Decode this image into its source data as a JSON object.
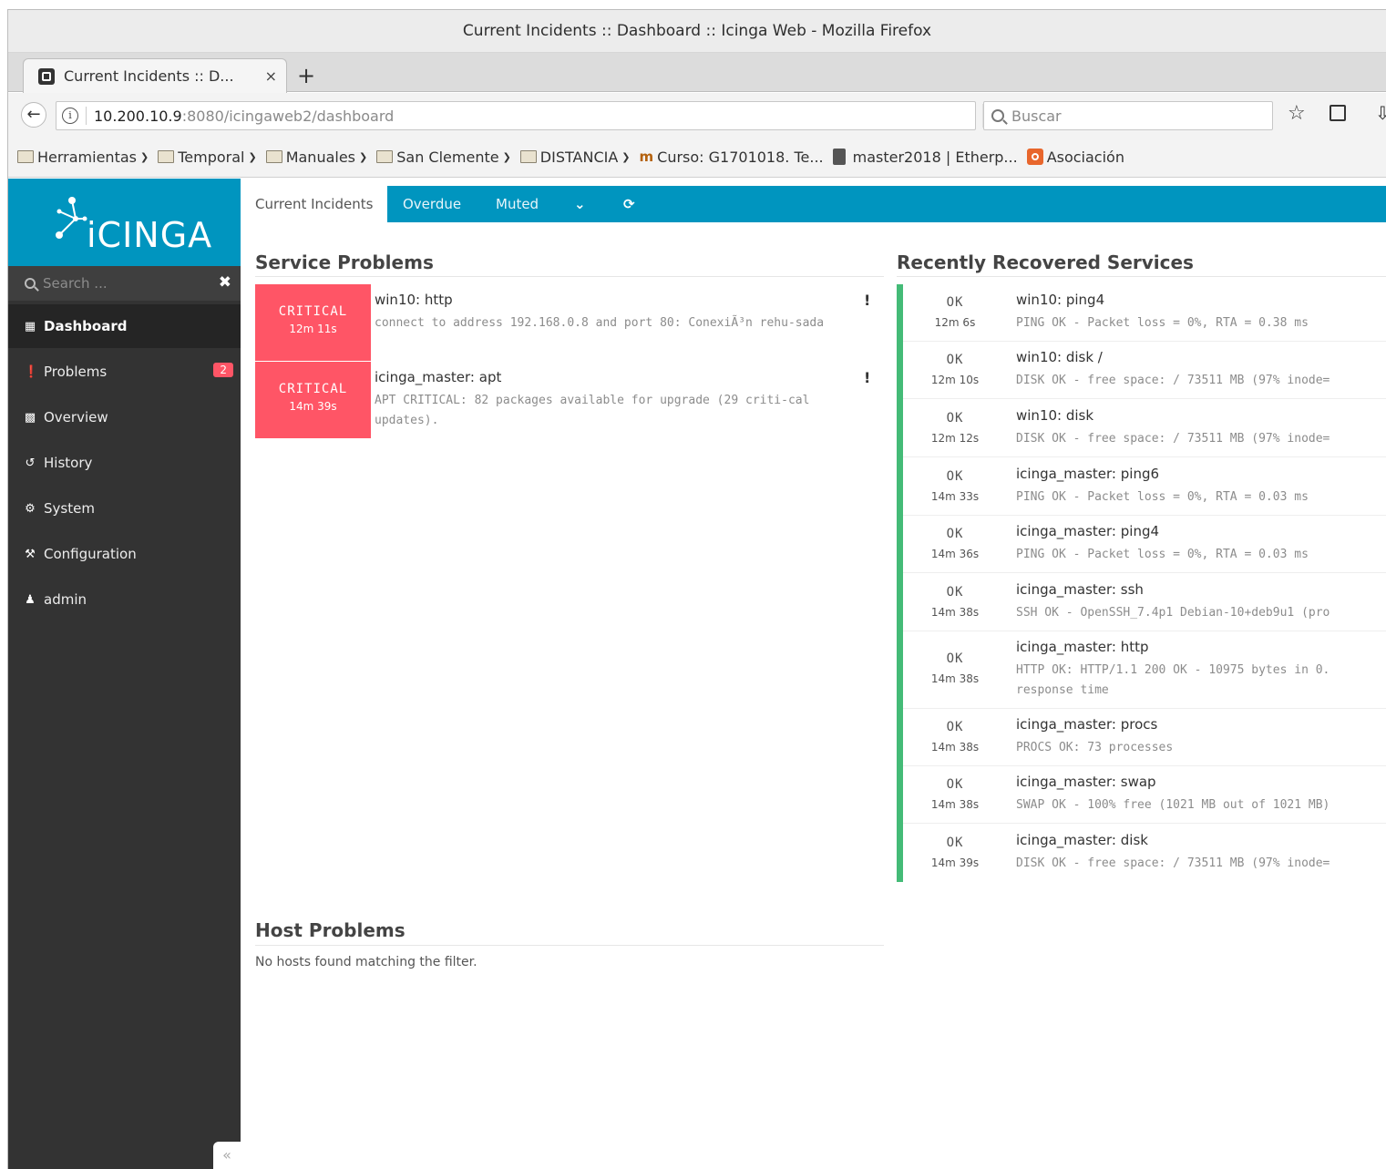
{
  "window": {
    "title": "Current Incidents :: Dashboard :: Icinga Web - Mozilla Firefox"
  },
  "browser": {
    "tab": {
      "label": "Current Incidents :: D...",
      "close": "×"
    },
    "new_tab": "+",
    "url": {
      "host": "10.200.10.9",
      "rest": ":8080/icingaweb2/dashboard"
    },
    "search_placeholder": "Buscar",
    "bookmarks": [
      {
        "label": "Herramientas",
        "type": "folder"
      },
      {
        "label": "Temporal",
        "type": "folder"
      },
      {
        "label": "Manuales",
        "type": "folder"
      },
      {
        "label": "San Clemente",
        "type": "folder"
      },
      {
        "label": "DISTANCIA",
        "type": "folder"
      },
      {
        "label": "Curso: G1701018. Te...",
        "type": "link"
      },
      {
        "label": "master2018 | Etherp...",
        "type": "link"
      },
      {
        "label": "Asociación",
        "type": "link"
      }
    ]
  },
  "sidebar": {
    "logo": "iCINGA",
    "search_placeholder": "Search ...",
    "items": [
      {
        "label": "Dashboard",
        "icon": "grid-icon",
        "active": true
      },
      {
        "label": "Problems",
        "icon": "alert-circle-icon",
        "badge": "2"
      },
      {
        "label": "Overview",
        "icon": "binoculars-icon"
      },
      {
        "label": "History",
        "icon": "history-icon"
      },
      {
        "label": "System",
        "icon": "gears-icon"
      },
      {
        "label": "Configuration",
        "icon": "wrench-icon"
      },
      {
        "label": "admin",
        "icon": "user-icon"
      }
    ],
    "collapse": "«"
  },
  "dashboard": {
    "tabs": [
      "Current Incidents",
      "Overdue",
      "Muted"
    ],
    "service_problems": {
      "title": "Service Problems",
      "rows": [
        {
          "state": "CRITICAL",
          "since": "12m 11s",
          "title": "win10: http",
          "output": "connect to address 192.168.0.8 and port 80: ConexiÃ³n rehu-sada"
        },
        {
          "state": "CRITICAL",
          "since": "14m 39s",
          "title": "icinga_master: apt",
          "output": "APT CRITICAL: 82 packages available for upgrade (29 criti-cal updates)."
        }
      ]
    },
    "host_problems": {
      "title": "Host Problems",
      "empty": "No hosts found matching the filter."
    },
    "recovered": {
      "title": "Recently Recovered Services",
      "rows": [
        {
          "state": "OK",
          "since": "12m 6s",
          "title": "win10: ping4",
          "output": "PING OK - Packet loss = 0%, RTA = 0.38 ms"
        },
        {
          "state": "OK",
          "since": "12m 10s",
          "title": "win10: disk /",
          "output": "DISK OK - free space: / 73511 MB (97% inode="
        },
        {
          "state": "OK",
          "since": "12m 12s",
          "title": "win10: disk",
          "output": "DISK OK - free space: / 73511 MB (97% inode="
        },
        {
          "state": "OK",
          "since": "14m 33s",
          "title": "icinga_master: ping6",
          "output": "PING OK - Packet loss = 0%, RTA = 0.03 ms"
        },
        {
          "state": "OK",
          "since": "14m 36s",
          "title": "icinga_master: ping4",
          "output": "PING OK - Packet loss = 0%, RTA = 0.03 ms"
        },
        {
          "state": "OK",
          "since": "14m 38s",
          "title": "icinga_master: ssh",
          "output": "SSH OK - OpenSSH_7.4p1 Debian-10+deb9u1 (pro"
        },
        {
          "state": "OK",
          "since": "14m 38s",
          "title": "icinga_master: http",
          "output": "HTTP OK: HTTP/1.1 200 OK - 10975 bytes in 0.",
          "output2": "response time"
        },
        {
          "state": "OK",
          "since": "14m 38s",
          "title": "icinga_master: procs",
          "output": "PROCS OK: 73 processes"
        },
        {
          "state": "OK",
          "since": "14m 38s",
          "title": "icinga_master: swap",
          "output": "SWAP OK - 100% free (1021 MB out of 1021 MB)"
        },
        {
          "state": "OK",
          "since": "14m 39s",
          "title": "icinga_master: disk",
          "output": "DISK OK - free space: / 73511 MB (97% inode="
        }
      ]
    }
  },
  "colors": {
    "brand": "#0095bf",
    "critical": "#ff5566",
    "ok": "#44bb77",
    "sidebar": "#333333"
  }
}
